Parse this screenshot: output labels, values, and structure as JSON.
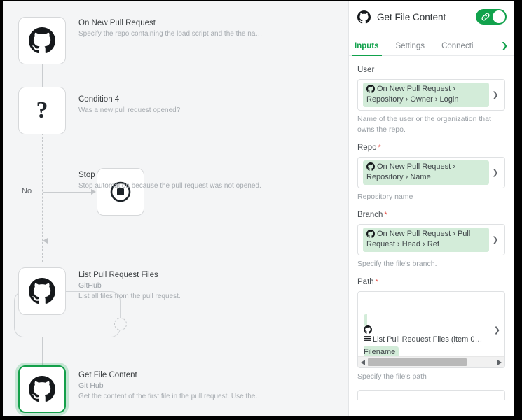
{
  "canvas": {
    "nodes": [
      {
        "id": "on-new-pull-request",
        "title": "On New Pull Request",
        "app": "",
        "description": "Specify the repo containing the load script and the the na…",
        "icon": "github-icon",
        "selected": false
      },
      {
        "id": "condition-4",
        "title": "Condition 4",
        "app": "",
        "description": "Was a new pull request opened?",
        "icon": "question-mark-icon",
        "selected": false
      },
      {
        "id": "stop",
        "title": "Stop",
        "app": "",
        "description": "Stop automation because the pull request was not opened.",
        "icon": "stop-icon",
        "selected": false
      },
      {
        "id": "list-pull-request-files",
        "title": "List Pull Request Files",
        "app": "GitHub",
        "description": "List all files from the pull request.",
        "icon": "github-icon",
        "selected": false
      },
      {
        "id": "get-file-content",
        "title": "Get File Content",
        "app": "Git Hub",
        "description": "Get the content of the first file in the pull request. Use the…",
        "icon": "github-icon",
        "selected": true
      }
    ],
    "branch_label_no": "No"
  },
  "panel": {
    "icon": "github-icon",
    "title": "Get File Content",
    "toggle": {
      "name": "connection-toggle",
      "state": "on",
      "icon": "chain-link-icon",
      "color": "#11a24c"
    },
    "tabs": [
      {
        "label": "Inputs",
        "active": true
      },
      {
        "label": "Settings",
        "active": false
      },
      {
        "label": "Connecti",
        "active": false
      }
    ],
    "tabs_more_icon": "chevron-right-icon",
    "fields": [
      {
        "label": "User",
        "required": false,
        "value_line1": "On New Pull Request ›",
        "value_line2": "Repository › Owner › Login",
        "value_icon": "github-icon",
        "chevron_icon": "chevron-down-icon",
        "hint": "Name of the user or the organization that owns the repo."
      },
      {
        "label": "Repo",
        "required": true,
        "value_line1": "On New Pull Request ›",
        "value_line2": "Repository › Name",
        "value_icon": "github-icon",
        "chevron_icon": "chevron-down-icon",
        "hint": "Repository name"
      },
      {
        "label": "Branch",
        "required": true,
        "value_line1": "On New Pull Request ›",
        "value_line2": "Pull Request › Head › Ref",
        "value_icon": "github-icon",
        "chevron_icon": "chevron-down-icon",
        "hint": "Specify the file's branch."
      }
    ],
    "path_field": {
      "label": "Path",
      "required": true,
      "value_icon": "github-icon",
      "list_icon": "list-icon",
      "value_line1": "List Pull Request Files (item 0…",
      "value_line2": "Filename",
      "chevron_icon": "chevron-down-icon",
      "hint": "Specify the file's path",
      "scrollbar": {
        "left_arrow_icon": "arrow-left-icon",
        "right_arrow_icon": "arrow-right-icon"
      }
    }
  },
  "colors": {
    "accent_green": "#11a24c",
    "chip_green": "#d3ecd9",
    "canvas_bg": "#f4f5f6",
    "required_red": "#e8584f"
  }
}
